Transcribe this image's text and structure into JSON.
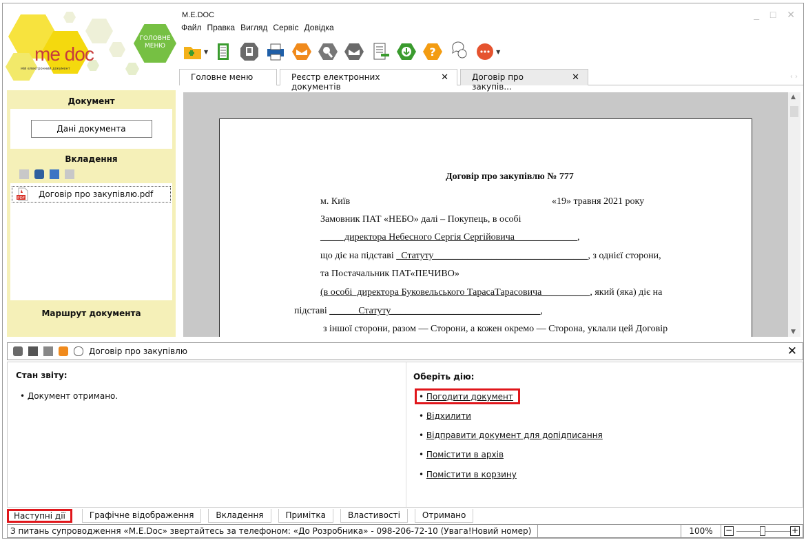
{
  "app": {
    "title": "M.E.DOC",
    "brand": "me doc",
    "brand_sub": "мій електронний документ",
    "home_label": "ГОЛОВНЕ МЕНЮ",
    "window_controls": "_ □ ✕"
  },
  "menu": [
    "Файл",
    "Правка",
    "Вигляд",
    "Сервіс",
    "Довідка"
  ],
  "toolbar_icons": [
    "new-document-icon",
    "document-list-icon",
    "save-icon",
    "print-icon",
    "envelope-icon",
    "sign-icon",
    "encrypt-icon",
    "export-icon",
    "download-icon",
    "help-icon",
    "chat-icon",
    "notifications-icon"
  ],
  "tabs": [
    {
      "label": "Головне меню",
      "closable": false
    },
    {
      "label": "Реєстр електронних документів",
      "closable": true
    },
    {
      "label": "Договір про закупів...",
      "closable": true,
      "active": true
    }
  ],
  "close_glyph": "✕",
  "left_panel": {
    "document_header": "Документ",
    "document_data_button": "Дані документа",
    "attachments_header": "Вкладення",
    "attachment_file": "Договір про закупівлю.pdf",
    "route_header": "Маршрут документа"
  },
  "document": {
    "title": "Договір про закупівлю № 777",
    "city": "м. Київ",
    "date": "«19» травня 2021 року",
    "l1": "Замовник ПАТ «НЕБО»   далі – Покупець, в особі",
    "l2": "_____директора Небесного Сергія Сергійовича_____________",
    "l2_end": ",",
    "l3_a": "що діє на підставі ",
    "l3_b": "_Статуту________________________________",
    "l3_c": ", з однієї сторони,",
    "l4": "та Постачальник ПАТ«ПЕЧИВО»",
    "l5_a": "(в особі_директора Буковельського ТарасаТарасовича__________",
    "l5_b": ", який (яка) діє на",
    "l6_a": "підставі ",
    "l6_b": "______Статуту_______________________________",
    "l6_c": ",",
    "l7": "з іншої сторони, разом — Сторони, а кожен окремо — Сторона,  уклали цей Договір"
  },
  "bottom_panel": {
    "title": "Договір про закупівлю",
    "status_header": "Стан звіту:",
    "status_item": "Документ отримано.",
    "actions_header": "Оберіть дію:",
    "actions": [
      "Погодити документ",
      "Відхилити",
      "Відправити документ для допідписання",
      "Помістити в архів",
      "Помістити в корзину"
    ]
  },
  "bottom_tabs": [
    "Наступні дії",
    "Графічне відображення",
    "Вкладення",
    "Примітка",
    "Властивості",
    "Отримано"
  ],
  "statusbar": {
    "message": "З питань супроводження «M.E.Doc» звертайтесь за телефоном: «До Розробника» - 098-206-72-10 (Увага!Новий номер)",
    "zoom": "100%",
    "zoom_out": "−",
    "zoom_in": "+"
  },
  "colors": {
    "accent_yellow": "#f5f0b8",
    "highlight": "#e0161b",
    "home_green": "#76c043",
    "brand_red": "#c73b3b"
  }
}
